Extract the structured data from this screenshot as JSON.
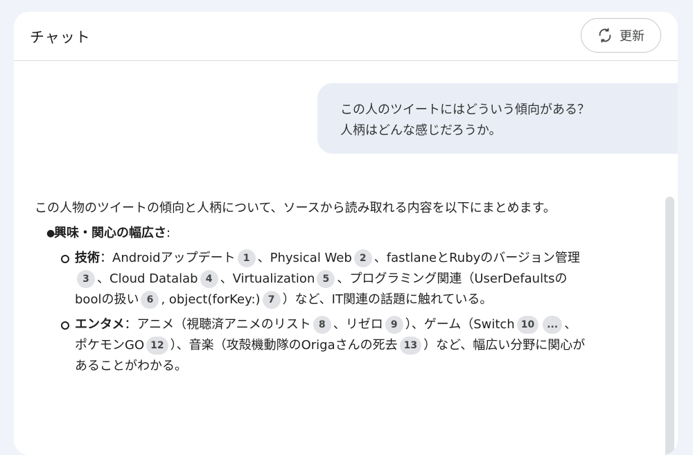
{
  "header": {
    "title": "チャット",
    "refresh_label": "更新"
  },
  "user_message": {
    "line1": "この人のツイートにはどういう傾向がある？",
    "line2": "人柄はどんな感じだろうか。"
  },
  "response": {
    "intro": "この人物のツイートの傾向と人柄について、ソースから読み取れる内容を以下にまとめます。",
    "section1": {
      "title": "興味・関心の幅広さ",
      "colon": ":"
    },
    "tech": {
      "label": "技術",
      "t1": "：Androidアップデート",
      "c1": "1",
      "t2": "、Physical Web",
      "c2": "2",
      "t3": "、fastlaneとRubyのバージョン管理",
      "c3": "3",
      "t4": "、Cloud Datalab",
      "c4": "4",
      "t5": "、Virtualization",
      "c5": "5",
      "t6": "、プログラミング関連（UserDefaultsのboolの扱い",
      "c6": "6",
      "t7": ", object(forKey:)",
      "c7": "7",
      "t8": "）など、IT関連の話題に触れている。"
    },
    "ent": {
      "label": "エンタメ",
      "t1": "：アニメ（視聴済アニメのリスト",
      "c8": "8",
      "t2": "、リゼロ",
      "c9": "9",
      "t3": "）、ゲーム（Switch",
      "c10": "10",
      "c11": "...",
      "t4": "、ポケモンGO",
      "c12": "12",
      "t5": "）、音楽（攻殻機動隊のOrigaさんの死去",
      "c13": "13",
      "t6": "）など、幅広い分野に関心があることがわかる。"
    }
  }
}
